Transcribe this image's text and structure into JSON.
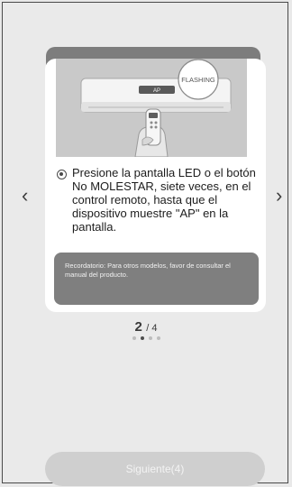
{
  "card": {
    "image": {
      "flashing_label": "FLASHING",
      "display_label": "AP"
    },
    "instruction": "Presione la pantalla LED o el botón No MOLESTAR, siete veces, en el control remoto, hasta que el dispositivo muestre \"AP\" en la pantalla.",
    "reminder": "Recordatorio: Para otros modelos, favor de consultar el manual del producto."
  },
  "nav": {
    "prev_icon": "chevron-left-icon",
    "prev_glyph": "‹",
    "next_icon": "chevron-right-icon",
    "next_glyph": "›"
  },
  "pager": {
    "current": "2",
    "separator_total": "/ 4",
    "dots": 4,
    "active_dot": 2
  },
  "footer": {
    "next_button": "Siguiente(4)"
  },
  "colors": {
    "background": "#eaeaea",
    "card": "#ffffff",
    "reminder_bg": "#7f7f7f",
    "button_disabled": "#cfcfcf"
  }
}
